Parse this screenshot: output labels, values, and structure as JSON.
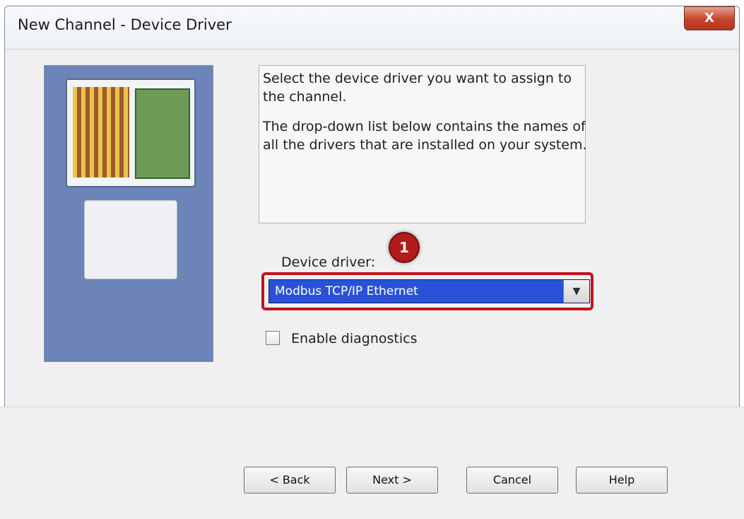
{
  "window": {
    "title": "New Channel - Device Driver",
    "close_label": "X"
  },
  "description": {
    "paragraph1": "Select the device driver you want to assign to the channel.",
    "paragraph2": "The drop-down list below contains the names of all the drivers that are installed on your system."
  },
  "driver": {
    "label": "Device driver:",
    "selected": "Modbus TCP/IP Ethernet",
    "badge_number": "1"
  },
  "options": {
    "enable_diagnostics_label": "Enable diagnostics",
    "enable_diagnostics_checked": false
  },
  "buttons": {
    "back": "< Back",
    "next": "Next >",
    "cancel": "Cancel",
    "help": "Help"
  },
  "colors": {
    "highlight": "#c1121d",
    "selection": "#2a52d8"
  },
  "icons": {
    "close": "close-icon",
    "dropdown": "chevron-down-icon",
    "illustration": "computer-device-illustration"
  }
}
